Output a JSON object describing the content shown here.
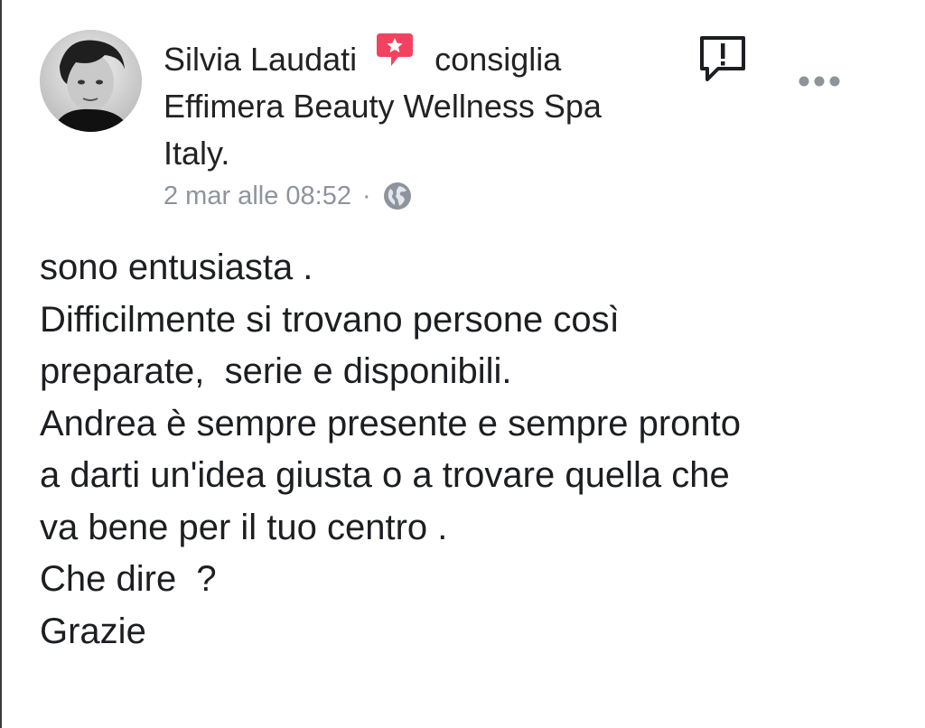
{
  "post": {
    "author": "Silvia Laudati",
    "action": "consiglia",
    "page_name": "Effimera Beauty Wellness Spa",
    "location": "Italy.",
    "timestamp": "2 mar alle 08:52",
    "separator": "·",
    "privacy_icon": "globe-icon",
    "recommend_icon": "recommendation-badge-icon",
    "report_icon": "report-icon",
    "more_icon": "more-options-icon",
    "body_lines": [
      "sono entusiasta .",
      "Difficilmente si trovano persone così",
      "preparate,  serie e disponibili.",
      "Andrea è sempre presente e sempre pronto",
      "a darti un'idea giusta o a trovare quella che",
      "va bene per il tuo centro .",
      "Che dire  ?",
      "Grazie"
    ]
  },
  "colors": {
    "badge": "#f3425f",
    "meta_text": "#8d949e",
    "body_text": "#1c1e21"
  }
}
